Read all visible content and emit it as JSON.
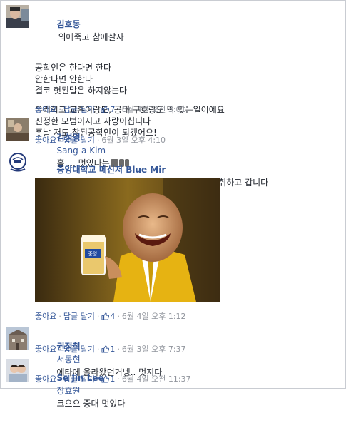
{
  "comments": [
    {
      "author": "김호동",
      "first_line": "의에죽고 참에살자",
      "paragraph1": "공학인은 한다면 한다\n안한다면 안한다\n결코 헛된말은 하지않는다",
      "paragraph2": "우리학교 교훈이랑도, 공대 구호랑도 딱 맞는일이에요\n진정한 모범이시고 자랑이십니다\n훗날 저도 참된공학인이 되겠어요!",
      "actions": {
        "like": "좋아요",
        "reply": "답글 달기",
        "like_count": "7",
        "timestamp": "6월 4일 오전 3:01"
      }
    },
    {
      "author": "김성경",
      "tag": "Sang-a Kim",
      "text": "홀 ... 멋있다는",
      "actions": {
        "like": "좋아요",
        "reply": "답글 달기",
        "timestamp": "6월 3일 오후 4:10"
      }
    },
    {
      "author": "중앙대학교 메신저 Blue Mir",
      "text": "Kya~~ 역시 중앙대 교수님 클라스.. 오늘도 취하고 갑니다",
      "image": {
        "label": "중앙"
      },
      "actions": {
        "like": "좋아요",
        "reply": "답글 달기",
        "like_count": "4",
        "timestamp": "6월 4일 오후 1:12"
      }
    },
    {
      "author": "권정혁",
      "tag": "서동현",
      "text": "에타에 올라왔던거넹.. 멋지다",
      "actions": {
        "like": "좋아요",
        "reply": "답글 달기",
        "like_count": "1",
        "timestamp": "6월 3일 오후 7:37"
      }
    },
    {
      "author": "Se Jin Lee",
      "tag": "장효원",
      "text": "크으으 중대 멋있다",
      "actions": {
        "like": "좋아요",
        "reply": "답글 달기",
        "like_count": "1",
        "timestamp": "6월 4일 오전 11:37"
      }
    }
  ],
  "colors": {
    "link": "#365899",
    "meta": "#90949c",
    "text": "#1d2129"
  }
}
